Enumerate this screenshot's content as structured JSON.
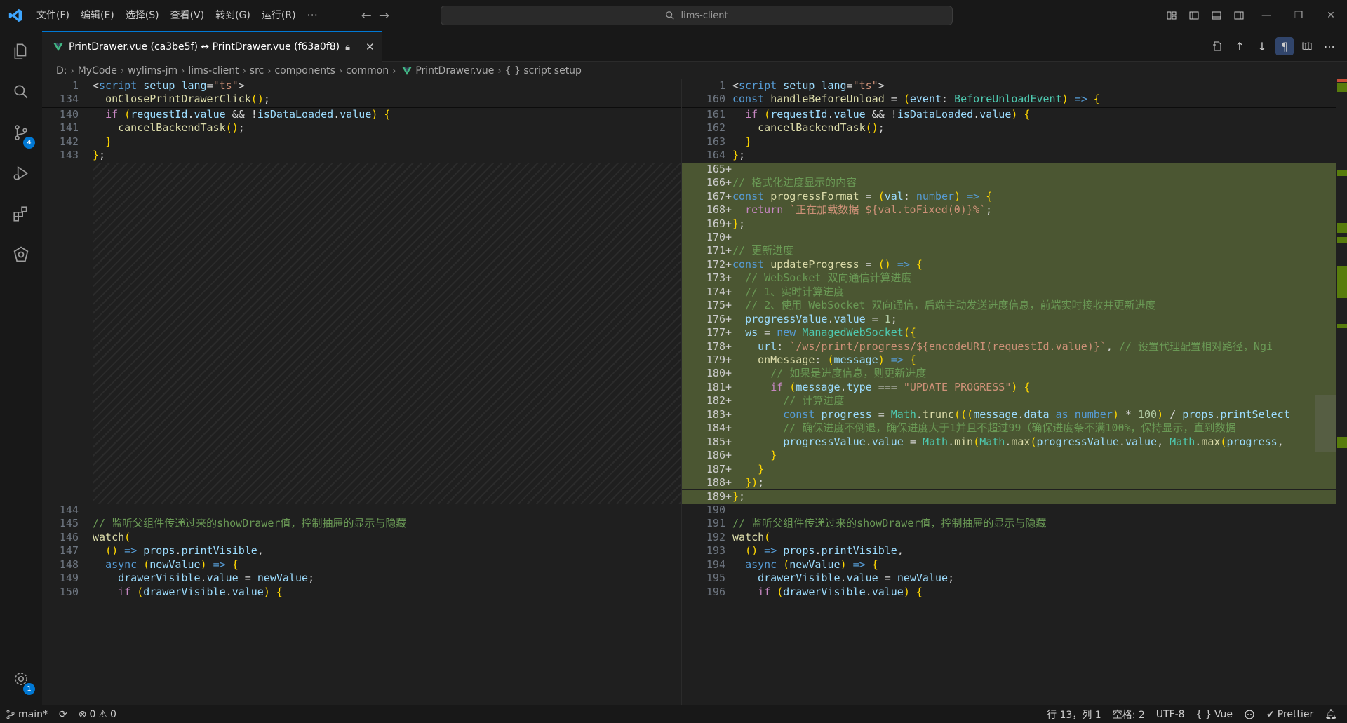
{
  "titlebar": {
    "menus": [
      "文件(F)",
      "编辑(E)",
      "选择(S)",
      "查看(V)",
      "转到(G)",
      "运行(R)"
    ],
    "more": "···",
    "search_text": "lims-client",
    "accent": "#0078d4"
  },
  "activity": {
    "items": [
      "explorer-icon",
      "search-icon",
      "source-control-icon",
      "run-debug-icon",
      "extensions-icon",
      "remote-icon"
    ],
    "scm_badge": "4",
    "settings_badge": "1"
  },
  "tab": {
    "label": "PrintDrawer.vue (ca3be5f) ↔ PrintDrawer.vue (f63a0f8)"
  },
  "breadcrumb": [
    "D:",
    "MyCode",
    "wylims-jm",
    "lims-client",
    "src",
    "components",
    "common",
    "PrintDrawer.vue",
    "{ } script setup"
  ],
  "left": {
    "sticky": [
      {
        "ln": "1",
        "text": "<script setup lang=\"ts\">"
      },
      {
        "ln": "134",
        "text": "  onClosePrintDrawerClick();"
      }
    ],
    "lines": [
      {
        "ln": "140",
        "text": "  if (requestId.value && !isDataLoaded.value) {"
      },
      {
        "ln": "141",
        "text": "    cancelBackendTask();"
      },
      {
        "ln": "142",
        "text": "  }"
      },
      {
        "ln": "143",
        "text": "};"
      },
      {
        "ln": "144",
        "text": ""
      },
      {
        "ln": "145",
        "text": "// 监听父组件传递过来的showDrawer值，控制抽屉的显示与隐藏"
      },
      {
        "ln": "146",
        "text": "watch("
      },
      {
        "ln": "147",
        "text": "  () => props.printVisible,"
      },
      {
        "ln": "148",
        "text": "  async (newValue) => {"
      },
      {
        "ln": "149",
        "text": "    drawerVisible.value = newValue;"
      },
      {
        "ln": "150",
        "text": "    if (drawerVisible.value) {"
      }
    ]
  },
  "right": {
    "sticky": [
      {
        "ln": "1",
        "text": "<script setup lang=\"ts\">"
      },
      {
        "ln": "160",
        "text": "const handleBeforeUnload = (event: BeforeUnloadEvent) => {"
      }
    ],
    "lines": [
      {
        "ln": "161",
        "added": false,
        "text": "  if (requestId.value && !isDataLoaded.value) {"
      },
      {
        "ln": "162",
        "added": false,
        "text": "    cancelBackendTask();"
      },
      {
        "ln": "163",
        "added": false,
        "text": "  }"
      },
      {
        "ln": "164",
        "added": false,
        "text": "};"
      },
      {
        "ln": "165",
        "added": true,
        "text": ""
      },
      {
        "ln": "166",
        "added": true,
        "text": "// 格式化进度显示的内容"
      },
      {
        "ln": "167",
        "added": true,
        "text": "const progressFormat = (val: number) => {"
      },
      {
        "ln": "168",
        "added": true,
        "text": "  return `正在加载数据 ${val.toFixed(0)}%`;"
      },
      {
        "ln": "169",
        "added": true,
        "text": "};"
      },
      {
        "ln": "170",
        "added": true,
        "text": ""
      },
      {
        "ln": "171",
        "added": true,
        "text": "// 更新进度"
      },
      {
        "ln": "172",
        "added": true,
        "text": "const updateProgress = () => {"
      },
      {
        "ln": "173",
        "added": true,
        "text": "  // WebSocket 双向通信计算进度"
      },
      {
        "ln": "174",
        "added": true,
        "text": "  // 1、实时计算进度"
      },
      {
        "ln": "175",
        "added": true,
        "text": "  // 2、使用 WebSocket 双向通信，后端主动发送进度信息，前端实时接收并更新进度"
      },
      {
        "ln": "176",
        "added": true,
        "text": "  progressValue.value = 1;"
      },
      {
        "ln": "177",
        "added": true,
        "text": "  ws = new ManagedWebSocket({"
      },
      {
        "ln": "178",
        "added": true,
        "text": "    url: `/ws/print/progress/${encodeURI(requestId.value)}`, // 设置代理配置相对路径，Ngi"
      },
      {
        "ln": "179",
        "added": true,
        "text": "    onMessage: (message) => {"
      },
      {
        "ln": "180",
        "added": true,
        "text": "      // 如果是进度信息，则更新进度"
      },
      {
        "ln": "181",
        "added": true,
        "text": "      if (message.type === \"UPDATE_PROGRESS\") {"
      },
      {
        "ln": "182",
        "added": true,
        "text": "        // 计算进度"
      },
      {
        "ln": "183",
        "added": true,
        "text": "        const progress = Math.trunc(((message.data as number) * 100) / props.printSelect"
      },
      {
        "ln": "184",
        "added": true,
        "text": "        // 确保进度不倒退，确保进度大于1并且不超过99（确保进度条不满100%，保持显示，直到数据"
      },
      {
        "ln": "185",
        "added": true,
        "text": "        progressValue.value = Math.min(Math.max(progressValue.value, Math.max(progress,"
      },
      {
        "ln": "186",
        "added": true,
        "text": "      }"
      },
      {
        "ln": "187",
        "added": true,
        "text": "    }"
      },
      {
        "ln": "188",
        "added": true,
        "text": "  });"
      },
      {
        "ln": "189",
        "added": true,
        "text": "};"
      },
      {
        "ln": "190",
        "added": false,
        "text": ""
      },
      {
        "ln": "191",
        "added": false,
        "text": "// 监听父组件传递过来的showDrawer值，控制抽屉的显示与隐藏"
      },
      {
        "ln": "192",
        "added": false,
        "text": "watch("
      },
      {
        "ln": "193",
        "added": false,
        "text": "  () => props.printVisible,"
      },
      {
        "ln": "194",
        "added": false,
        "text": "  async (newValue) => {"
      },
      {
        "ln": "195",
        "added": false,
        "text": "    drawerVisible.value = newValue;"
      },
      {
        "ln": "196",
        "added": false,
        "text": "    if (drawerVisible.value) {"
      }
    ]
  },
  "status": {
    "branch": "main*",
    "errors": "0",
    "warnings": "0",
    "position": "行 13，列 1",
    "spaces": "空格: 2",
    "encoding": "UTF-8",
    "language": "Vue",
    "prettier": "Prettier"
  }
}
